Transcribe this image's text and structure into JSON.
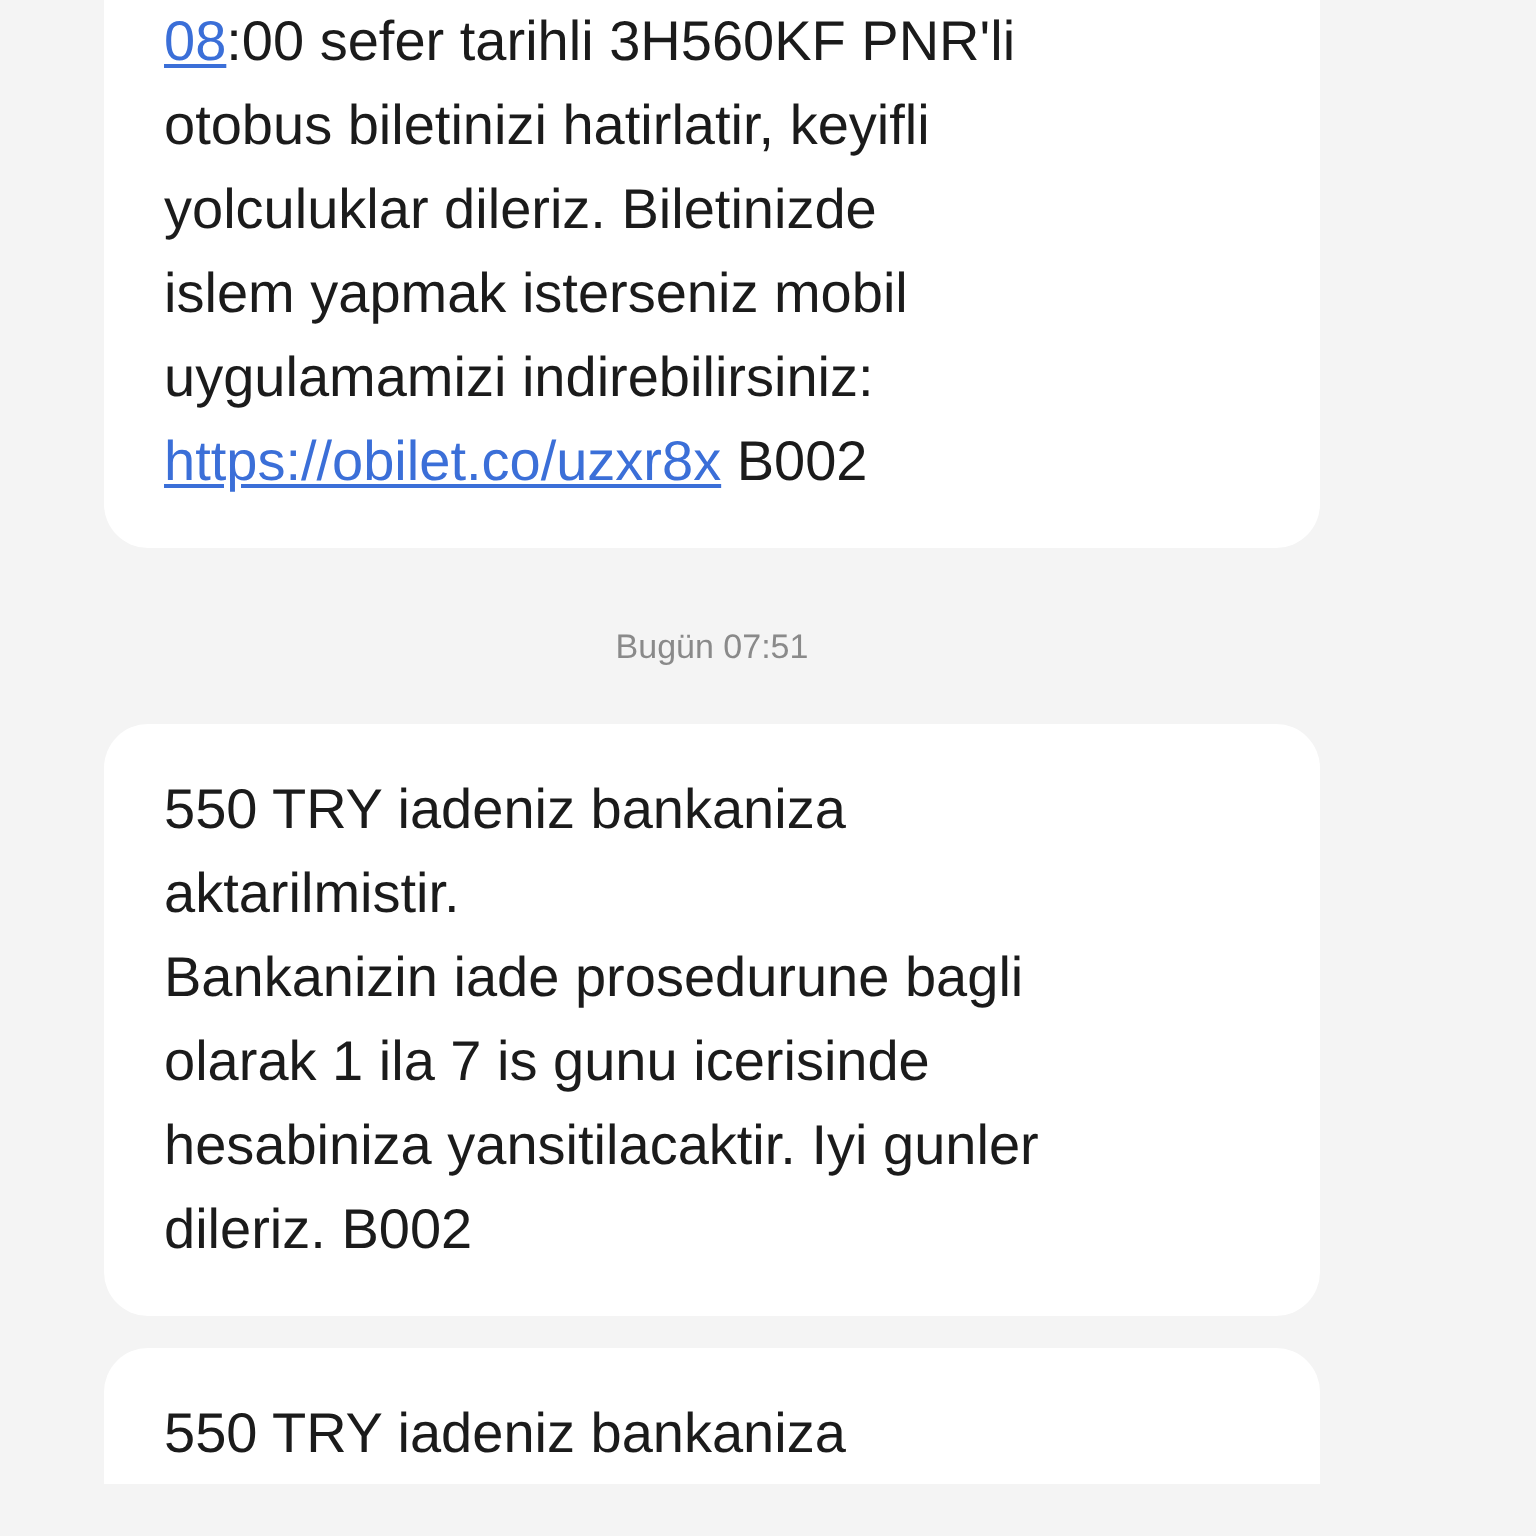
{
  "messages": [
    {
      "kind": "message",
      "parts": [
        {
          "kind": "link",
          "text": "08"
        },
        {
          "kind": "text",
          "text": ":00 sefer tarihli 3H560KF PNR'li\notobus biletinizi hatirlatir, keyifli\nyolculuklar dileriz. Biletinizde\nislem yapmak isterseniz mobil\nuygulamamizi indirebilirsiniz:\n"
        },
        {
          "kind": "link",
          "text": "https://obilet.co/uzxr8x"
        },
        {
          "kind": "text",
          "text": " B002"
        }
      ]
    },
    {
      "kind": "timestamp",
      "text": "Bugün 07:51"
    },
    {
      "kind": "message",
      "parts": [
        {
          "kind": "text",
          "text": "550 TRY iadeniz bankaniza\naktarilmistir.\nBankanizin iade prosedurune bagli\nolarak 1 ila 7 is gunu icerisinde\nhesabiniza yansitilacaktir. Iyi gunler\ndileriz. B002"
        }
      ]
    },
    {
      "kind": "message",
      "parts": [
        {
          "kind": "text",
          "text": "550 TRY iadeniz bankaniza"
        }
      ]
    }
  ]
}
